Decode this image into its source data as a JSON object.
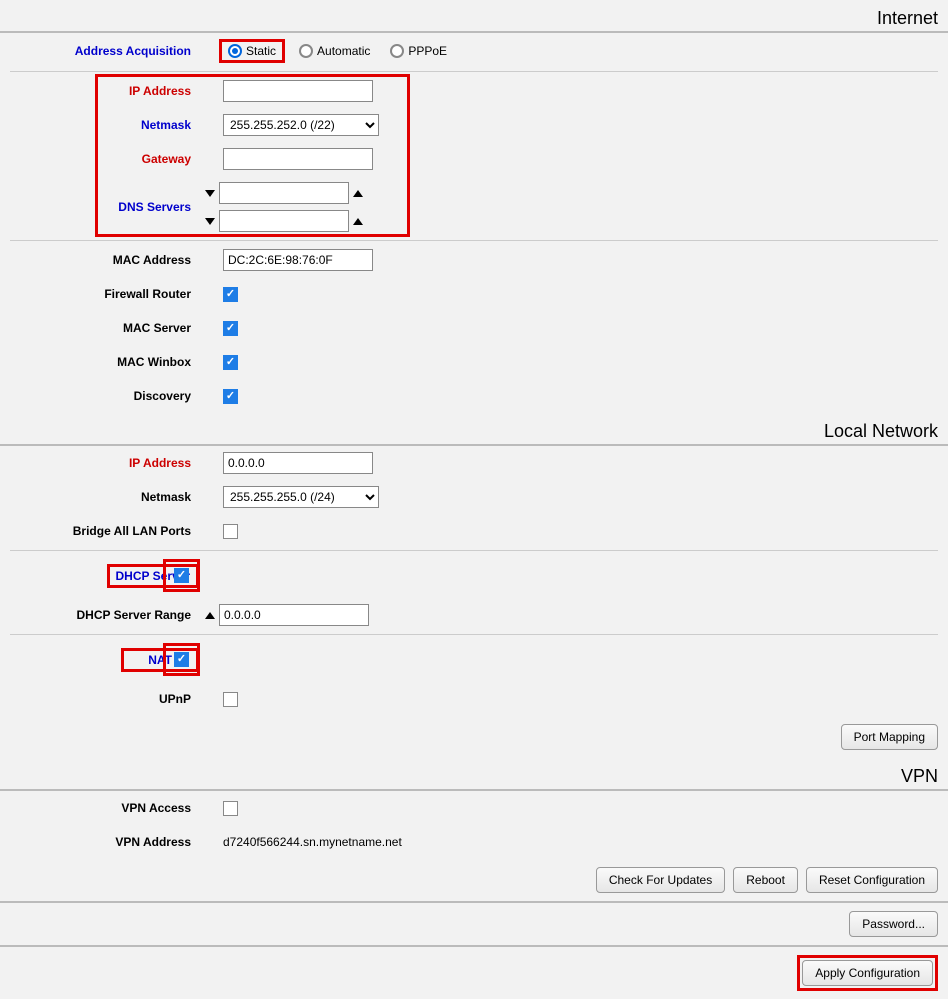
{
  "sections": {
    "internet": "Internet",
    "local": "Local Network",
    "vpn": "VPN"
  },
  "internet": {
    "address_acquisition_label": "Address Acquisition",
    "radio": {
      "static": "Static",
      "automatic": "Automatic",
      "pppoe": "PPPoE",
      "selected": "static"
    },
    "ip_address_label": "IP Address",
    "ip_address_value": "",
    "netmask_label": "Netmask",
    "netmask_value": "255.255.252.0 (/22)",
    "gateway_label": "Gateway",
    "gateway_value": "",
    "dns_label": "DNS Servers",
    "dns1_value": "",
    "dns2_value": "",
    "mac_address_label": "MAC Address",
    "mac_address_value": "DC:2C:6E:98:76:0F",
    "firewall_label": "Firewall Router",
    "mac_server_label": "MAC Server",
    "mac_winbox_label": "MAC Winbox",
    "discovery_label": "Discovery"
  },
  "local": {
    "ip_address_label": "IP Address",
    "ip_address_value": "0.0.0.0",
    "netmask_label": "Netmask",
    "netmask_value": "255.255.255.0 (/24)",
    "bridge_label": "Bridge All LAN Ports",
    "dhcp_server_label": "DHCP Server",
    "dhcp_range_label": "DHCP Server Range",
    "dhcp_range_value": "0.0.0.0",
    "nat_label": "NAT",
    "upnp_label": "UPnP",
    "port_mapping_btn": "Port Mapping"
  },
  "vpn": {
    "access_label": "VPN Access",
    "address_label": "VPN Address",
    "address_value": "d7240f566244.sn.mynetname.net"
  },
  "buttons": {
    "check_updates": "Check For Updates",
    "reboot": "Reboot",
    "reset_config": "Reset Configuration",
    "password": "Password...",
    "apply": "Apply Configuration"
  }
}
